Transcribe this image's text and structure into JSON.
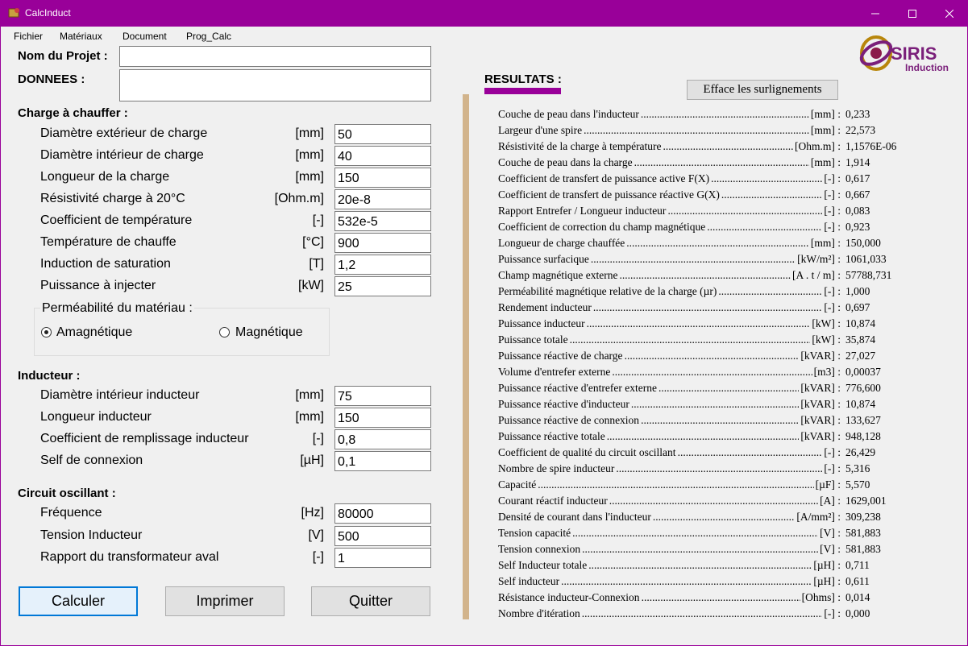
{
  "window": {
    "title": "CalcInduct"
  },
  "menu": [
    "Fichier",
    "Matériaux",
    "Document",
    "Prog_Calc"
  ],
  "project": {
    "name_label": "Nom du Projet :",
    "name_value": "",
    "data_label": "DONNEES :",
    "data_value": ""
  },
  "charge": {
    "title": "Charge à chauffer :",
    "fields": [
      {
        "label": "Diamètre extérieur de charge",
        "unit": "[mm]",
        "value": "50"
      },
      {
        "label": "Diamètre intérieur de charge",
        "unit": "[mm]",
        "value": "40"
      },
      {
        "label": "Longueur de la charge",
        "unit": "[mm]",
        "value": "150"
      },
      {
        "label": "Résistivité  charge à 20°C",
        "unit": "[Ohm.m]",
        "value": "20e-8"
      },
      {
        "label": "Coefficient de température",
        "unit": "[-]",
        "value": "532e-5"
      },
      {
        "label": "Température de chauffe",
        "unit": "[°C]",
        "value": "900"
      },
      {
        "label": "Induction de saturation",
        "unit": "[T]",
        "value": "1,2"
      },
      {
        "label": "Puissance à injecter",
        "unit": "[kW]",
        "value": "25"
      }
    ],
    "permeability": {
      "title": "Perméabilité du matériau :",
      "options": [
        "Amagnétique",
        "Magnétique"
      ],
      "selected": "Amagnétique"
    }
  },
  "inducteur": {
    "title": "Inducteur :",
    "fields": [
      {
        "label": "Diamètre intérieur inducteur",
        "unit": "[mm]",
        "value": "75"
      },
      {
        "label": "Longueur inducteur",
        "unit": "[mm]",
        "value": "150"
      },
      {
        "label": "Coefficient de remplissage inducteur",
        "unit": "[-]",
        "value": "0,8"
      },
      {
        "label": "Self de connexion",
        "unit": "[µH]",
        "value": "0,1"
      }
    ]
  },
  "circuit": {
    "title": "Circuit oscillant :",
    "fields": [
      {
        "label": "Fréquence",
        "unit": "[Hz]",
        "value": "80000"
      },
      {
        "label": "Tension Inducteur",
        "unit": "[V]",
        "value": "500"
      },
      {
        "label": "Rapport du transformateur aval",
        "unit": "[-]",
        "value": "1"
      }
    ]
  },
  "buttons": {
    "calc": "Calculer",
    "print": "Imprimer",
    "quit": "Quitter",
    "clear": "Efface les surlignements"
  },
  "results": {
    "title": "RESULTATS :",
    "rows": [
      {
        "label": "Couche de peau dans l'inducteur",
        "unit": "[mm] :",
        "value": "0,233"
      },
      {
        "label": "Largeur d'une spire",
        "unit": "[mm] :",
        "value": "22,573"
      },
      {
        "label": "Résistivité de la charge à température",
        "unit": "[Ohm.m] :",
        "value": "1,1576E-06"
      },
      {
        "label": "Couche de peau dans la charge",
        "unit": "[mm] :",
        "value": "1,914"
      },
      {
        "label": "Coefficient de transfert de puissance active F(X)",
        "unit": "[-] :",
        "value": "0,617"
      },
      {
        "label": "Coefficient de transfert de puissance réactive G(X)",
        "unit": "[-] :",
        "value": "0,667"
      },
      {
        "label": "Rapport Entrefer / Longueur inducteur",
        "unit": "[-] :",
        "value": "0,083"
      },
      {
        "label": "Coefficient de correction du champ magnétique",
        "unit": "[-] :",
        "value": "0,923"
      },
      {
        "label": "Longueur de charge chauffée",
        "unit": "[mm] :",
        "value": "150,000"
      },
      {
        "label": "Puissance surfacique",
        "unit": "[kW/m²] :",
        "value": "1061,033"
      },
      {
        "label": "Champ magnétique externe",
        "unit": "[A . t / m] :",
        "value": "57788,731"
      },
      {
        "label": "Perméabilité magnétique relative de la charge (µr)",
        "unit": "[-] :",
        "value": "1,000"
      },
      {
        "label": "Rendement inducteur",
        "unit": "[-] :",
        "value": "0,697"
      },
      {
        "label": "Puissance inducteur",
        "unit": "[kW] :",
        "value": "10,874"
      },
      {
        "label": "Puissance totale",
        "unit": "[kW] :",
        "value": "35,874"
      },
      {
        "label": "Puissance réactive de charge",
        "unit": "[kVAR] :",
        "value": "27,027"
      },
      {
        "label": "Volume d'entrefer externe",
        "unit": "[m3] :",
        "value": "0,00037"
      },
      {
        "label": "Puissance réactive d'entrefer externe",
        "unit": "[kVAR] :",
        "value": "776,600"
      },
      {
        "label": "Puissance réactive d'inducteur",
        "unit": "[kVAR] :",
        "value": "10,874"
      },
      {
        "label": "Puissance réactive de connexion",
        "unit": "[kVAR] :",
        "value": "133,627"
      },
      {
        "label": "Puissance réactive totale",
        "unit": "[kVAR] :",
        "value": "948,128"
      },
      {
        "label": "Coefficient de qualité du circuit oscillant",
        "unit": "[-] :",
        "value": "26,429"
      },
      {
        "label": "Nombre de spire inducteur",
        "unit": "[-] :",
        "value": "5,316"
      },
      {
        "label": "Capacité",
        "unit": "[µF] :",
        "value": "5,570"
      },
      {
        "label": "Courant réactif inducteur",
        "unit": "[A] :",
        "value": "1629,001"
      },
      {
        "label": "Densité de courant dans l'inducteur",
        "unit": "[A/mm²] :",
        "value": "309,238"
      },
      {
        "label": "Tension capacité",
        "unit": "[V] :",
        "value": "581,883"
      },
      {
        "label": "Tension connexion",
        "unit": "[V] :",
        "value": "581,883"
      },
      {
        "label": "Self Inducteur totale",
        "unit": "[µH] :",
        "value": "0,711"
      },
      {
        "label": "Self inducteur",
        "unit": "[µH] :",
        "value": "0,611"
      },
      {
        "label": "Résistance inducteur-Connexion",
        "unit": "[Ohms] :",
        "value": "0,014"
      },
      {
        "label": "Nombre d'itération",
        "unit": "[-] :",
        "value": "0,000"
      }
    ]
  },
  "logo": {
    "brand": "SIRIS",
    "sub": "Induction"
  },
  "colors": {
    "titlebar": "#990099",
    "accent": "#990099",
    "divider": "#d2b48c",
    "default_button_border": "#0078d7"
  }
}
